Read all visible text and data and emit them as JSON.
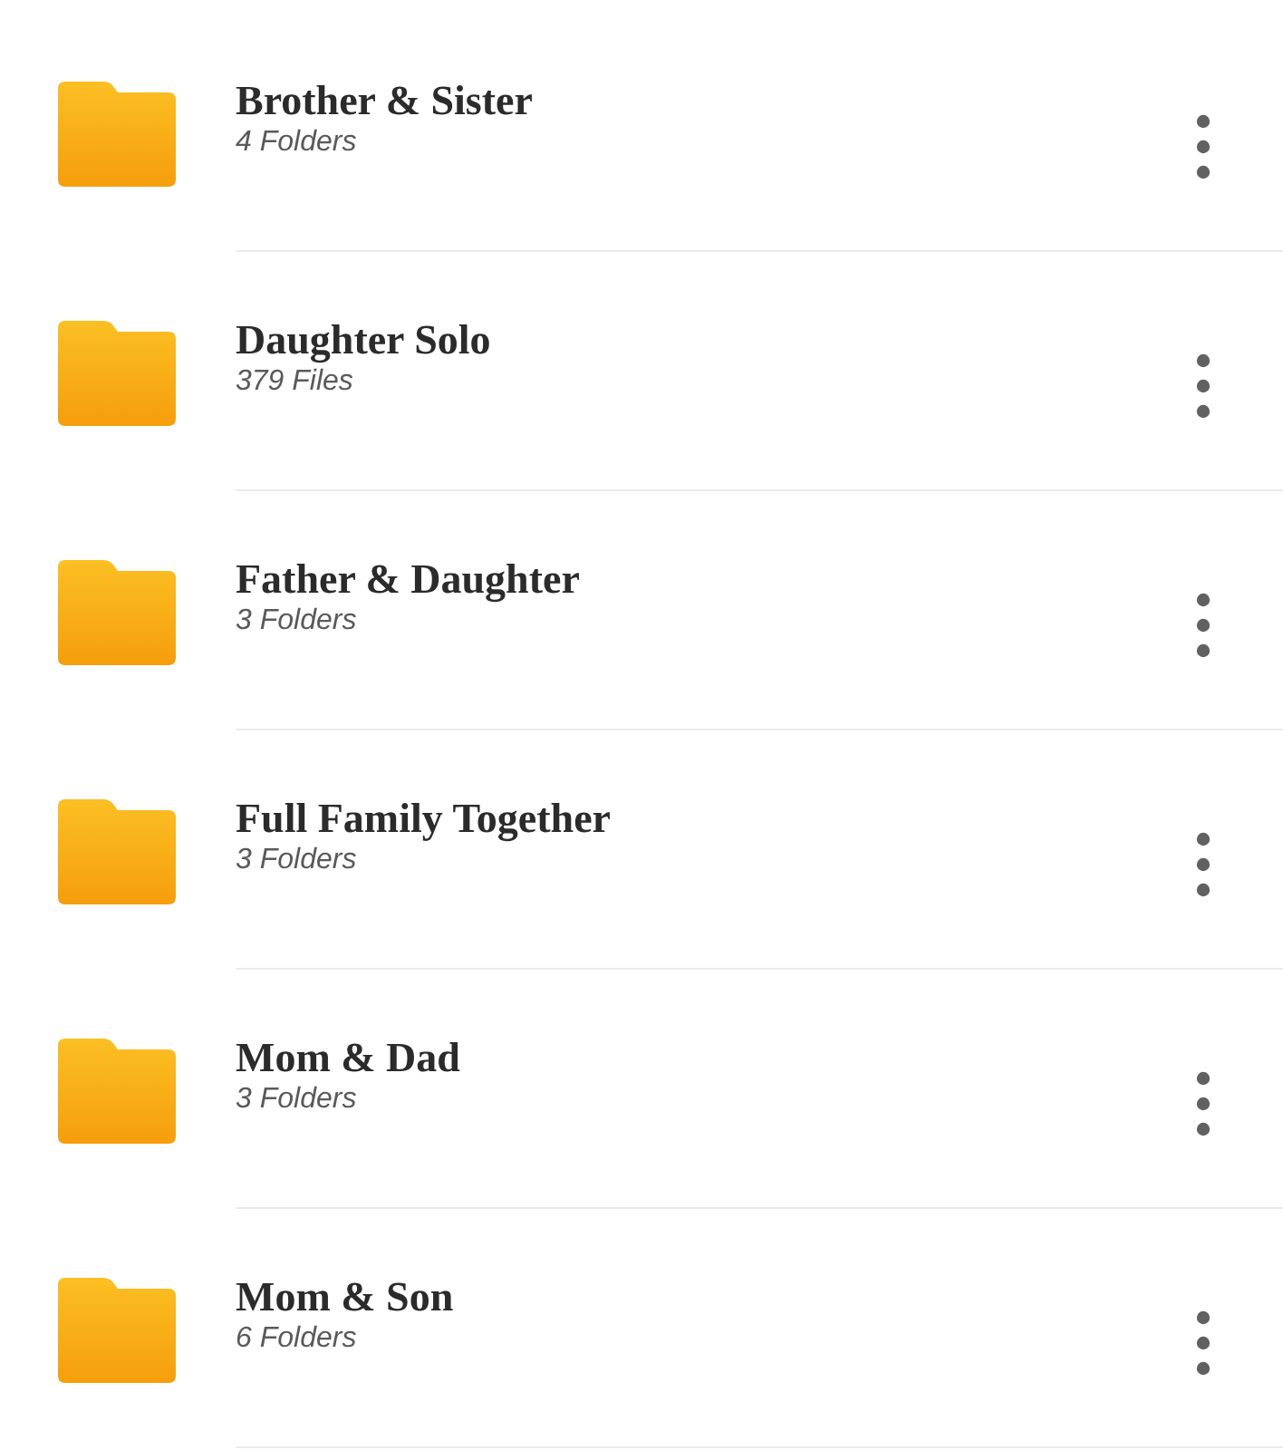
{
  "folders": [
    {
      "name": "Brother & Sister",
      "count": "4 Folders"
    },
    {
      "name": "Daughter Solo",
      "count": "379 Files"
    },
    {
      "name": "Father & Daughter",
      "count": "3 Folders"
    },
    {
      "name": "Full Family Together",
      "count": "3 Folders"
    },
    {
      "name": "Mom & Dad",
      "count": "3 Folders"
    },
    {
      "name": "Mom & Son",
      "count": "6 Folders"
    }
  ]
}
